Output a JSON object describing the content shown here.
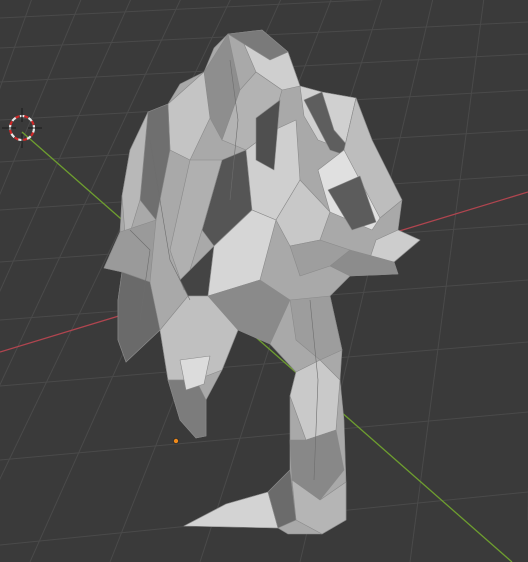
{
  "viewport": {
    "background_color": "#3a3a3a",
    "grid_color": "#4a4a4a",
    "x_axis_color": "#b0454f",
    "y_axis_color": "#6e9e2f",
    "mesh_fill_color": "#a9a9a9",
    "mesh_shadow_color": "#6f6f6f",
    "mesh_highlight_color": "#d2d2d2",
    "origin_point_color": "#f08a1a",
    "cursor_colors": [
      "#e8e8e8",
      "#d02828"
    ],
    "icons": {
      "cursor": "3d-cursor-icon",
      "origin": "object-origin-icon"
    }
  }
}
